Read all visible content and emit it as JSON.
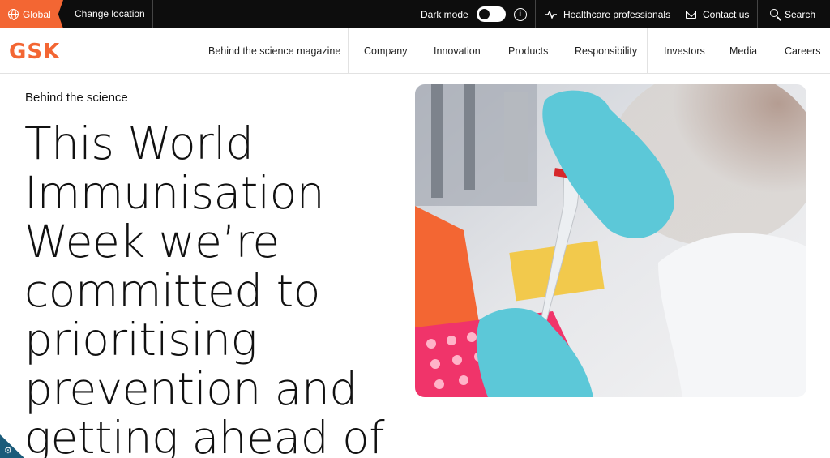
{
  "topbar": {
    "global_label": "Global",
    "change_location": "Change location",
    "dark_mode_label": "Dark mode",
    "info_glyph": "i",
    "healthcare": "Healthcare professionals",
    "contact": "Contact us",
    "search": "Search"
  },
  "nav": {
    "logo": "GSK",
    "items": [
      "Behind the science magazine",
      "Company",
      "Innovation",
      "Products",
      "Responsibility",
      "Investors",
      "Media",
      "Careers"
    ]
  },
  "article": {
    "eyebrow": "Behind the science",
    "headline": "This World Immunisation Week we’re committed to prioritising prevention and getting ahead of"
  },
  "colors": {
    "brand_orange": "#f36633",
    "topbar_bg": "#0d0d0d",
    "glove_blue": "#5cc8d8",
    "tray_pink": "#f0346a"
  },
  "icons": {
    "globe": "globe-icon",
    "info": "info-icon",
    "healthcare": "pulse-icon",
    "contact": "mail-icon",
    "search": "search-icon",
    "cookie": "gear-icon"
  }
}
